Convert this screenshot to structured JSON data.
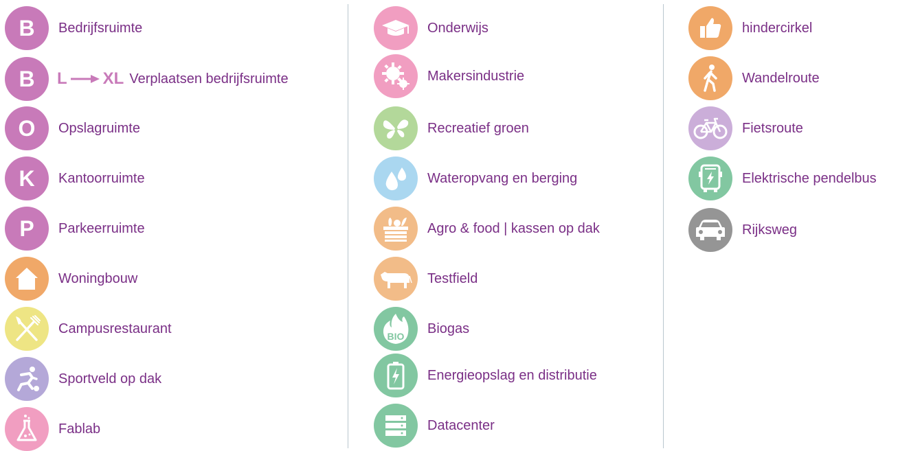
{
  "colors": {
    "label_text": "#7a2f86",
    "purple_pink": "#c87ab9",
    "orange": "#f0a868",
    "yellow": "#eee584",
    "lavender": "#b4a8d8",
    "pink": "#f19ec1",
    "green_light": "#b3d89a",
    "blue_light": "#aad7f0",
    "peach": "#f2bc88",
    "teal_green": "#82c7a1",
    "lilac": "#cbaed9",
    "gray": "#959595",
    "divider": "#b9c6cf"
  },
  "column1": [
    {
      "icon": "letter-b-icon",
      "letter": "B",
      "label": "Bedrijfsruimte"
    },
    {
      "icon": "letter-b-icon",
      "letter": "B",
      "scale_from": "L",
      "scale_to": "XL",
      "label": "Verplaatsen bedrijfsruimte"
    },
    {
      "icon": "letter-o-icon",
      "letter": "O",
      "label": "Opslagruimte"
    },
    {
      "icon": "letter-k-icon",
      "letter": "K",
      "label": "Kantoorruimte"
    },
    {
      "icon": "letter-p-icon",
      "letter": "P",
      "label": "Parkeerruimte"
    },
    {
      "icon": "house-icon",
      "label": "Woningbouw"
    },
    {
      "icon": "fork-knife-icon",
      "label": "Campusrestaurant"
    },
    {
      "icon": "runner-ball-icon",
      "label": "Sportveld op dak"
    },
    {
      "icon": "flask-icon",
      "label": "Fablab"
    }
  ],
  "column2": [
    {
      "icon": "graduation-cap-icon",
      "label": "Onderwijs"
    },
    {
      "icon": "gears-icon",
      "label": "Makersindustrie"
    },
    {
      "icon": "butterfly-icon",
      "label": "Recreatief groen"
    },
    {
      "icon": "water-drops-icon",
      "label": "Wateropvang en berging"
    },
    {
      "icon": "crate-plants-icon",
      "label": "Agro & food | kassen op dak"
    },
    {
      "icon": "cow-icon",
      "label": "Testfield"
    },
    {
      "icon": "bio-flame-icon",
      "label": "Biogas"
    },
    {
      "icon": "battery-icon",
      "label": "Energieopslag en distributie"
    },
    {
      "icon": "server-icon",
      "label": "Datacenter"
    }
  ],
  "column3": [
    {
      "icon": "thumbs-up-icon",
      "label": "hindercirkel"
    },
    {
      "icon": "walking-person-icon",
      "label": "Wandelroute"
    },
    {
      "icon": "bicycle-icon",
      "label": "Fietsroute"
    },
    {
      "icon": "electric-bus-icon",
      "label": "Elektrische pendelbus"
    },
    {
      "icon": "car-icon",
      "label": "Rijksweg"
    }
  ]
}
